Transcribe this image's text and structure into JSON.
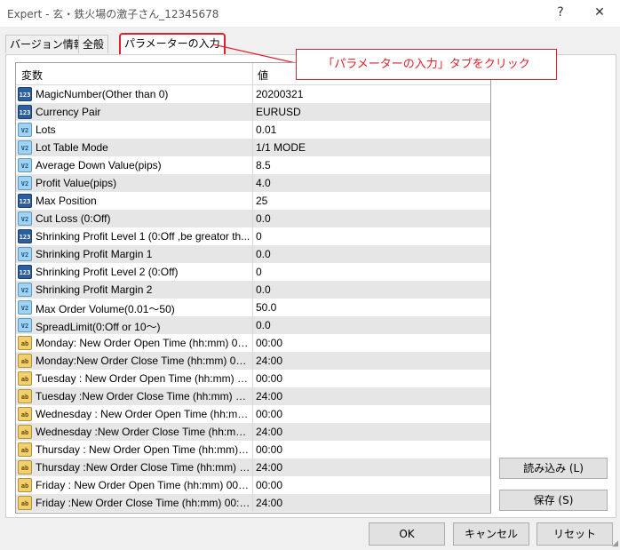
{
  "window": {
    "title": "Expert - 玄・鉄火場の激子さん_12345678",
    "help_label": "?",
    "close_label": "✕"
  },
  "tabs": [
    {
      "label": "バージョン情報"
    },
    {
      "label": "全般"
    },
    {
      "label": "パラメーターの入力",
      "active": true
    }
  ],
  "callout": {
    "text": "「パラメーターの入力」タブをクリック",
    "color": "#e0202a"
  },
  "grid": {
    "columns": [
      "変数",
      "値"
    ],
    "rows": [
      {
        "icon": "int",
        "name": "MagicNumber(Other than 0)",
        "value": "20200321"
      },
      {
        "icon": "int",
        "name": "Currency Pair",
        "value": "EURUSD"
      },
      {
        "icon": "dbl",
        "name": "Lots",
        "value": "0.01"
      },
      {
        "icon": "dbl",
        "name": "Lot Table Mode",
        "value": "1/1 MODE"
      },
      {
        "icon": "dbl",
        "name": "Average Down Value(pips)",
        "value": "8.5"
      },
      {
        "icon": "dbl",
        "name": "Profit Value(pips)",
        "value": "4.0"
      },
      {
        "icon": "int",
        "name": "Max Position",
        "value": "25"
      },
      {
        "icon": "dbl",
        "name": "Cut Loss (0:Off)",
        "value": "0.0"
      },
      {
        "icon": "int",
        "name": "Shrinking Profit Level 1 (0:Off ,be greator th...",
        "value": "0"
      },
      {
        "icon": "dbl",
        "name": "Shrinking Profit Margin 1",
        "value": "0.0"
      },
      {
        "icon": "int",
        "name": "Shrinking Profit Level 2 (0:Off)",
        "value": "0"
      },
      {
        "icon": "dbl",
        "name": "Shrinking Profit Margin 2",
        "value": "0.0"
      },
      {
        "icon": "dbl",
        "name": "Max Order Volume(0.01〜50)",
        "value": "50.0"
      },
      {
        "icon": "dbl",
        "name": "SpreadLimit(0:Off or 10〜)",
        "value": "0.0"
      },
      {
        "icon": "str",
        "name": "Monday: New Order Open Time (hh:mm) 00:...",
        "value": "00:00"
      },
      {
        "icon": "str",
        "name": "Monday:New Order Close Time (hh:mm) 00:...",
        "value": "24:00"
      },
      {
        "icon": "str",
        "name": "Tuesday : New Order Open Time (hh:mm) 00...",
        "value": "00:00"
      },
      {
        "icon": "str",
        "name": "Tuesday :New Order Close Time (hh:mm) 00:...",
        "value": "24:00"
      },
      {
        "icon": "str",
        "name": "Wednesday : New Order Open Time (hh:mm...",
        "value": "00:00"
      },
      {
        "icon": "str",
        "name": "Wednesday :New Order Close Time (hh:mm)...",
        "value": "24:00"
      },
      {
        "icon": "str",
        "name": "Thursday : New Order Open Time (hh:mm) 0...",
        "value": "00:00"
      },
      {
        "icon": "str",
        "name": "Thursday :New Order Close Time (hh:mm) 0...",
        "value": "24:00"
      },
      {
        "icon": "str",
        "name": "Friday : New Order Open Time (hh:mm) 00:0...",
        "value": "00:00"
      },
      {
        "icon": "str",
        "name": "Friday :New Order Close Time (hh:mm) 00:01...",
        "value": "24:00"
      }
    ]
  },
  "icons": {
    "int": "123",
    "dbl": "V2",
    "str": "ab"
  },
  "side_buttons": {
    "load": "読み込み (L)",
    "save": "保存 (S)"
  },
  "bottom_buttons": {
    "ok": "OK",
    "cancel": "キャンセル",
    "reset": "リセット"
  }
}
